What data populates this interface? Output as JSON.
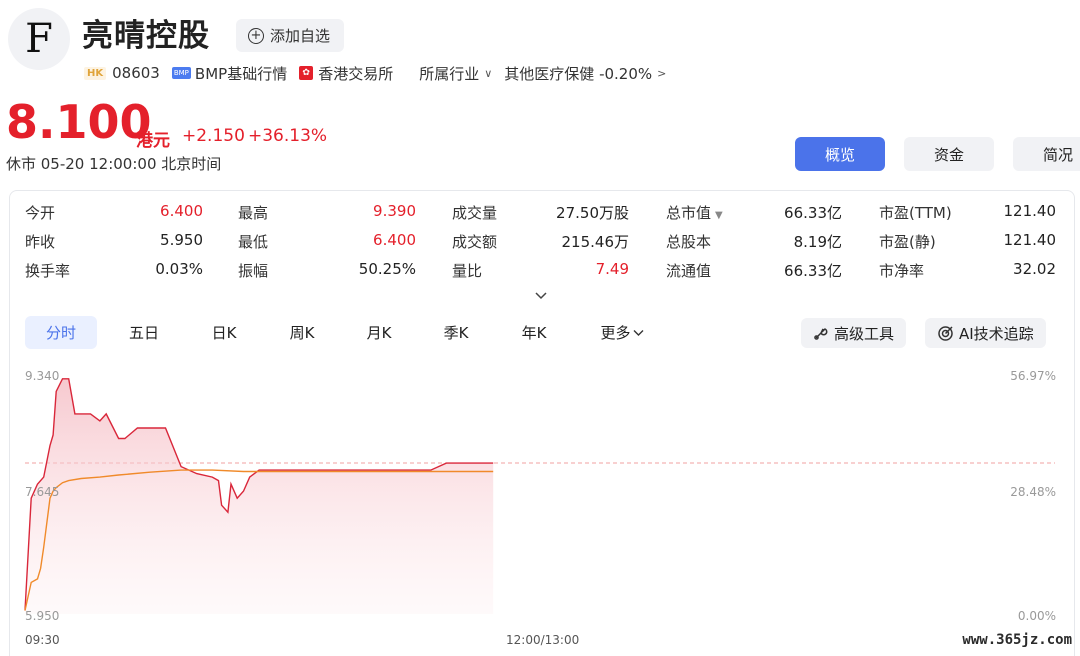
{
  "header": {
    "logo_letter": "F",
    "title": "亮晴控股",
    "add_watchlist": "添加自选",
    "market_tag": "HK",
    "code": "08603",
    "bmp_tag": "BMP",
    "bmp_label": "BMP基础行情",
    "exchange": "香港交易所",
    "industry_label": "所属行业",
    "industry_value": "其他医疗保健 -0.20%"
  },
  "quote": {
    "price": "8.100",
    "currency": "港元",
    "change": "+2.150",
    "change_pct": "+36.13%",
    "status_time": "休市 05-20 12:00:00 北京时间"
  },
  "top_tabs": [
    "概览",
    "资金",
    "简况"
  ],
  "stats": [
    [
      {
        "label": "今开",
        "value": "6.400",
        "red": true
      },
      {
        "label": "最高",
        "value": "9.390",
        "red": true
      },
      {
        "label": "成交量",
        "value": "27.50万股",
        "red": false
      },
      {
        "label": "总市值",
        "value": "66.33亿",
        "red": false,
        "dropdown": true
      },
      {
        "label": "市盈(TTM)",
        "value": "121.40",
        "red": false
      }
    ],
    [
      {
        "label": "昨收",
        "value": "5.950",
        "red": false
      },
      {
        "label": "最低",
        "value": "6.400",
        "red": true
      },
      {
        "label": "成交额",
        "value": "215.46万",
        "red": false
      },
      {
        "label": "总股本",
        "value": "8.19亿",
        "red": false
      },
      {
        "label": "市盈(静)",
        "value": "121.40",
        "red": false
      }
    ],
    [
      {
        "label": "换手率",
        "value": "0.03%",
        "red": false
      },
      {
        "label": "振幅",
        "value": "50.25%",
        "red": false
      },
      {
        "label": "量比",
        "value": "7.49",
        "red": true
      },
      {
        "label": "流通值",
        "value": "66.33亿",
        "red": false
      },
      {
        "label": "市净率",
        "value": "32.02",
        "red": false
      }
    ]
  ],
  "period_tabs": [
    "分时",
    "五日",
    "日K",
    "周K",
    "月K",
    "季K",
    "年K",
    "更多"
  ],
  "tools": {
    "advanced": "高级工具",
    "ai_tracking": "AI技术追踪"
  },
  "chart_data": {
    "type": "line",
    "y_left_ticks": [
      "9.340",
      "7.645",
      "5.950"
    ],
    "y_right_ticks": [
      "56.97%",
      "28.48%",
      "0.00%"
    ],
    "x_ticks": [
      "09:30",
      "12:00/13:00"
    ],
    "ylim": [
      5.95,
      9.34
    ],
    "prev_close_reference": 8.1,
    "colors": {
      "price": "#d9273a",
      "average": "#f08a2a",
      "reference": "#f0a0a0"
    },
    "series": [
      {
        "role": "price",
        "x": [
          0,
          2,
          4,
          6,
          8,
          9,
          10,
          12,
          14,
          16,
          18,
          21,
          24,
          26,
          30,
          32,
          36,
          40,
          45,
          50,
          55,
          60,
          62,
          63,
          65,
          66,
          68,
          70,
          72,
          75,
          78,
          80,
          82,
          83,
          84,
          85,
          86,
          88,
          90,
          95,
          100,
          110,
          120,
          130,
          135,
          140,
          150
        ],
        "y": [
          6.0,
          7.6,
          7.8,
          7.9,
          8.35,
          8.5,
          9.12,
          9.3,
          9.3,
          8.8,
          8.8,
          8.8,
          8.7,
          8.8,
          8.45,
          8.45,
          8.6,
          8.6,
          8.6,
          8.05,
          7.95,
          7.9,
          7.85,
          7.5,
          7.4,
          7.8,
          7.6,
          7.7,
          7.9,
          8.0,
          8.0,
          8.0,
          8.0,
          8.0,
          8.0,
          8.0,
          8.0,
          8.0,
          8.0,
          8.0,
          8.0,
          8.0,
          8.0,
          8.0,
          8.1,
          8.1,
          8.1
        ]
      },
      {
        "role": "average",
        "x": [
          0,
          2,
          4,
          5,
          6,
          8,
          9,
          10,
          12,
          14,
          18,
          24,
          30,
          40,
          50,
          60,
          70,
          80,
          90,
          100,
          110,
          120,
          130,
          140,
          150
        ],
        "y": [
          6.0,
          6.4,
          6.45,
          6.6,
          6.9,
          7.6,
          7.7,
          7.75,
          7.82,
          7.85,
          7.88,
          7.9,
          7.93,
          7.97,
          8.0,
          8.0,
          7.98,
          7.98,
          7.98,
          7.98,
          7.98,
          7.98,
          7.98,
          7.98,
          7.98
        ]
      }
    ]
  },
  "watermark": "www.365jz.com"
}
